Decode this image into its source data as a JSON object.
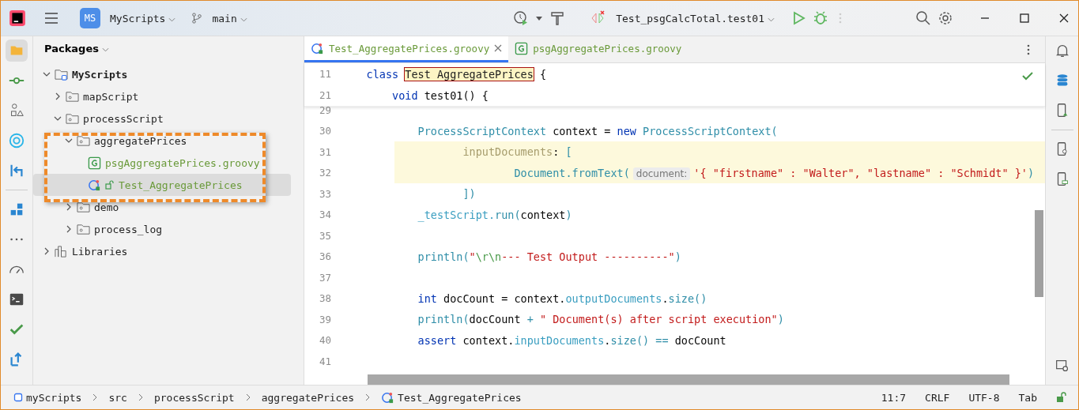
{
  "title_bar": {
    "project_badge": "MS",
    "project": "MyScripts",
    "branch": "main",
    "run_config": "Test_psgCalcTotal.test01"
  },
  "packages_panel": {
    "title": "Packages",
    "tree": [
      {
        "label": "MyScripts",
        "kind": "module",
        "expanded": true,
        "selected": false,
        "new_file": false,
        "children": [
          {
            "label": "mapScript",
            "kind": "package",
            "expanded": false,
            "selected": false,
            "new_file": false
          },
          {
            "label": "processScript",
            "kind": "package",
            "expanded": true,
            "selected": false,
            "new_file": false,
            "children": [
              {
                "label": "aggregatePrices",
                "kind": "package",
                "expanded": true,
                "selected": false,
                "new_file": false,
                "children": [
                  {
                    "label": "psgAggregatePrices.groovy",
                    "kind": "groovy",
                    "selected": false,
                    "new_file": true
                  },
                  {
                    "label": "Test_AggregatePrices",
                    "kind": "test",
                    "selected": true,
                    "new_file": true
                  }
                ]
              },
              {
                "label": "demo",
                "kind": "package",
                "expanded": false,
                "selected": false,
                "new_file": false
              },
              {
                "label": "process_log",
                "kind": "package",
                "expanded": false,
                "selected": false,
                "new_file": false
              }
            ]
          }
        ]
      },
      {
        "label": "Libraries",
        "kind": "library",
        "expanded": false,
        "selected": false,
        "new_file": false
      }
    ]
  },
  "editor": {
    "tabs": [
      {
        "label": "Test_AggregatePrices.groovy",
        "kind": "test",
        "selected": true,
        "new_file": true
      },
      {
        "label": "psgAggregatePrices.groovy",
        "kind": "groovy",
        "selected": false,
        "new_file": true
      }
    ],
    "sticky_lines": [
      {
        "number": "11",
        "highlighted": false,
        "tokens": [
          {
            "t": "    class ",
            "kind": "kw"
          },
          {
            "t": "Test_AggregatePrices",
            "kind": "match"
          },
          {
            "t": " {",
            "kind": "plain"
          }
        ]
      },
      {
        "number": "21",
        "highlighted": false,
        "tokens": [
          {
            "t": "        void",
            "kind": "kw"
          },
          {
            "t": " test01() {",
            "kind": "plain"
          }
        ]
      }
    ],
    "lines": [
      {
        "number": "29",
        "highlighted": false
      },
      {
        "number": "30",
        "highlighted": false,
        "tokens": [
          {
            "t": "            ProcessScriptContext",
            "kind": "cls"
          },
          {
            "t": " context = ",
            "kind": "plain"
          },
          {
            "t": "new",
            "kind": "kw"
          },
          {
            "t": " ProcessScriptContext(",
            "kind": "cls"
          }
        ]
      },
      {
        "number": "31",
        "highlighted": true,
        "tokens": [
          {
            "t": "                   inputDocuments",
            "kind": "param"
          },
          {
            "t": ": ",
            "kind": "plain"
          },
          {
            "t": "[",
            "kind": "method"
          }
        ]
      },
      {
        "number": "32",
        "highlighted": true,
        "tokens": [
          {
            "t": "                           Document.",
            "kind": "cls"
          },
          {
            "t": "fromText(",
            "kind": "method"
          },
          {
            "t": "document:",
            "kind": "hint"
          },
          {
            "t": "'{ \"firstname\" : \"Walter\", \"lastname\" : \"Schmidt\" }'",
            "kind": "str"
          },
          {
            "t": ")",
            "kind": "method"
          }
        ]
      },
      {
        "number": "33",
        "highlighted": false,
        "tokens": [
          {
            "t": "                   ])",
            "kind": "method"
          }
        ]
      },
      {
        "number": "34",
        "highlighted": false,
        "tokens": [
          {
            "t": "            _testScript.",
            "kind": "field"
          },
          {
            "t": "run(",
            "kind": "method"
          },
          {
            "t": "context",
            "kind": "plain"
          },
          {
            "t": ")",
            "kind": "method"
          }
        ]
      },
      {
        "number": "35",
        "highlighted": false
      },
      {
        "number": "36",
        "highlighted": false,
        "tokens": [
          {
            "t": "            println(",
            "kind": "method"
          },
          {
            "t": "\"",
            "kind": "str"
          },
          {
            "t": "\\r\\n",
            "kind": "esc"
          },
          {
            "t": "--- Test Output ----------\"",
            "kind": "str"
          },
          {
            "t": ")",
            "kind": "method"
          }
        ]
      },
      {
        "number": "37",
        "highlighted": false
      },
      {
        "number": "38",
        "highlighted": false,
        "tokens": [
          {
            "t": "            int",
            "kind": "kw"
          },
          {
            "t": " docCount = context.",
            "kind": "plain"
          },
          {
            "t": "outputDocuments",
            "kind": "field"
          },
          {
            "t": ".",
            "kind": "plain"
          },
          {
            "t": "size()",
            "kind": "method"
          }
        ]
      },
      {
        "number": "39",
        "highlighted": false,
        "tokens": [
          {
            "t": "            println(",
            "kind": "method"
          },
          {
            "t": "docCount ",
            "kind": "plain"
          },
          {
            "t": "+",
            "kind": "method"
          },
          {
            "t": " \" Document(s) after script execution\"",
            "kind": "str"
          },
          {
            "t": ")",
            "kind": "method"
          }
        ]
      },
      {
        "number": "40",
        "highlighted": false,
        "tokens": [
          {
            "t": "            assert",
            "kind": "kw"
          },
          {
            "t": " context.",
            "kind": "plain"
          },
          {
            "t": "inputDocuments",
            "kind": "field"
          },
          {
            "t": ".",
            "kind": "plain"
          },
          {
            "t": "size() ==",
            "kind": "method"
          },
          {
            "t": " docCount",
            "kind": "plain"
          }
        ]
      },
      {
        "number": "41",
        "highlighted": false
      }
    ]
  },
  "status_bar": {
    "breadcrumbs": [
      {
        "label": "myScripts",
        "kind": "module"
      },
      {
        "label": "src",
        "kind": "none"
      },
      {
        "label": "processScript",
        "kind": "none"
      },
      {
        "label": "aggregatePrices",
        "kind": "none"
      },
      {
        "label": "Test_AggregatePrices",
        "kind": "test"
      }
    ],
    "items": [
      "11:7",
      "CRLF",
      "UTF-8",
      "Tab"
    ]
  }
}
